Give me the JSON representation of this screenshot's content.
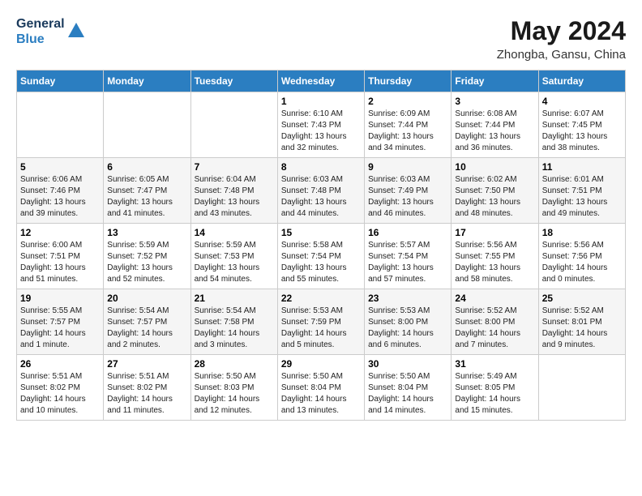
{
  "header": {
    "logo_line1": "General",
    "logo_line2": "Blue",
    "month_year": "May 2024",
    "location": "Zhongba, Gansu, China"
  },
  "days_of_week": [
    "Sunday",
    "Monday",
    "Tuesday",
    "Wednesday",
    "Thursday",
    "Friday",
    "Saturday"
  ],
  "weeks": [
    [
      {
        "day": "",
        "info": ""
      },
      {
        "day": "",
        "info": ""
      },
      {
        "day": "",
        "info": ""
      },
      {
        "day": "1",
        "info": "Sunrise: 6:10 AM\nSunset: 7:43 PM\nDaylight: 13 hours\nand 32 minutes."
      },
      {
        "day": "2",
        "info": "Sunrise: 6:09 AM\nSunset: 7:44 PM\nDaylight: 13 hours\nand 34 minutes."
      },
      {
        "day": "3",
        "info": "Sunrise: 6:08 AM\nSunset: 7:44 PM\nDaylight: 13 hours\nand 36 minutes."
      },
      {
        "day": "4",
        "info": "Sunrise: 6:07 AM\nSunset: 7:45 PM\nDaylight: 13 hours\nand 38 minutes."
      }
    ],
    [
      {
        "day": "5",
        "info": "Sunrise: 6:06 AM\nSunset: 7:46 PM\nDaylight: 13 hours\nand 39 minutes."
      },
      {
        "day": "6",
        "info": "Sunrise: 6:05 AM\nSunset: 7:47 PM\nDaylight: 13 hours\nand 41 minutes."
      },
      {
        "day": "7",
        "info": "Sunrise: 6:04 AM\nSunset: 7:48 PM\nDaylight: 13 hours\nand 43 minutes."
      },
      {
        "day": "8",
        "info": "Sunrise: 6:03 AM\nSunset: 7:48 PM\nDaylight: 13 hours\nand 44 minutes."
      },
      {
        "day": "9",
        "info": "Sunrise: 6:03 AM\nSunset: 7:49 PM\nDaylight: 13 hours\nand 46 minutes."
      },
      {
        "day": "10",
        "info": "Sunrise: 6:02 AM\nSunset: 7:50 PM\nDaylight: 13 hours\nand 48 minutes."
      },
      {
        "day": "11",
        "info": "Sunrise: 6:01 AM\nSunset: 7:51 PM\nDaylight: 13 hours\nand 49 minutes."
      }
    ],
    [
      {
        "day": "12",
        "info": "Sunrise: 6:00 AM\nSunset: 7:51 PM\nDaylight: 13 hours\nand 51 minutes."
      },
      {
        "day": "13",
        "info": "Sunrise: 5:59 AM\nSunset: 7:52 PM\nDaylight: 13 hours\nand 52 minutes."
      },
      {
        "day": "14",
        "info": "Sunrise: 5:59 AM\nSunset: 7:53 PM\nDaylight: 13 hours\nand 54 minutes."
      },
      {
        "day": "15",
        "info": "Sunrise: 5:58 AM\nSunset: 7:54 PM\nDaylight: 13 hours\nand 55 minutes."
      },
      {
        "day": "16",
        "info": "Sunrise: 5:57 AM\nSunset: 7:54 PM\nDaylight: 13 hours\nand 57 minutes."
      },
      {
        "day": "17",
        "info": "Sunrise: 5:56 AM\nSunset: 7:55 PM\nDaylight: 13 hours\nand 58 minutes."
      },
      {
        "day": "18",
        "info": "Sunrise: 5:56 AM\nSunset: 7:56 PM\nDaylight: 14 hours\nand 0 minutes."
      }
    ],
    [
      {
        "day": "19",
        "info": "Sunrise: 5:55 AM\nSunset: 7:57 PM\nDaylight: 14 hours\nand 1 minute."
      },
      {
        "day": "20",
        "info": "Sunrise: 5:54 AM\nSunset: 7:57 PM\nDaylight: 14 hours\nand 2 minutes."
      },
      {
        "day": "21",
        "info": "Sunrise: 5:54 AM\nSunset: 7:58 PM\nDaylight: 14 hours\nand 3 minutes."
      },
      {
        "day": "22",
        "info": "Sunrise: 5:53 AM\nSunset: 7:59 PM\nDaylight: 14 hours\nand 5 minutes."
      },
      {
        "day": "23",
        "info": "Sunrise: 5:53 AM\nSunset: 8:00 PM\nDaylight: 14 hours\nand 6 minutes."
      },
      {
        "day": "24",
        "info": "Sunrise: 5:52 AM\nSunset: 8:00 PM\nDaylight: 14 hours\nand 7 minutes."
      },
      {
        "day": "25",
        "info": "Sunrise: 5:52 AM\nSunset: 8:01 PM\nDaylight: 14 hours\nand 9 minutes."
      }
    ],
    [
      {
        "day": "26",
        "info": "Sunrise: 5:51 AM\nSunset: 8:02 PM\nDaylight: 14 hours\nand 10 minutes."
      },
      {
        "day": "27",
        "info": "Sunrise: 5:51 AM\nSunset: 8:02 PM\nDaylight: 14 hours\nand 11 minutes."
      },
      {
        "day": "28",
        "info": "Sunrise: 5:50 AM\nSunset: 8:03 PM\nDaylight: 14 hours\nand 12 minutes."
      },
      {
        "day": "29",
        "info": "Sunrise: 5:50 AM\nSunset: 8:04 PM\nDaylight: 14 hours\nand 13 minutes."
      },
      {
        "day": "30",
        "info": "Sunrise: 5:50 AM\nSunset: 8:04 PM\nDaylight: 14 hours\nand 14 minutes."
      },
      {
        "day": "31",
        "info": "Sunrise: 5:49 AM\nSunset: 8:05 PM\nDaylight: 14 hours\nand 15 minutes."
      },
      {
        "day": "",
        "info": ""
      }
    ]
  ]
}
